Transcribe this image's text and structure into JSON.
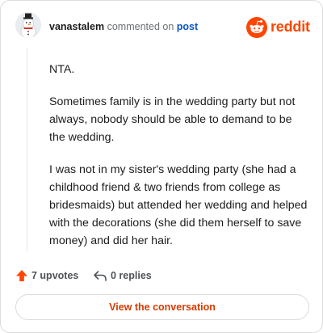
{
  "header": {
    "username": "vanastalem",
    "commented_on": "commented on",
    "post_link": "post",
    "brand": "reddit"
  },
  "comment": {
    "paragraphs": [
      "NTA.",
      "Sometimes family is in the wedding party but not always, nobody should be able to demand to be the wedding.",
      "I was not in my sister's wedding party (she had a childhood friend & two friends from college as bridesmaids) but attended her wedding and helped with the decorations (she did them herself to save money) and did her hair."
    ]
  },
  "actions": {
    "upvotes": "7 upvotes",
    "replies": "0 replies"
  },
  "cta": {
    "label": "View the conversation"
  },
  "colors": {
    "brand": "#ff4500",
    "link": "#0a55c4",
    "cta_text": "#d93a00"
  }
}
